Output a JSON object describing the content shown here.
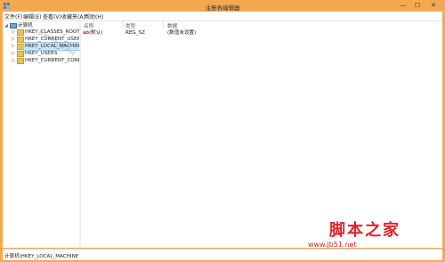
{
  "window": {
    "title": "注册表编辑器",
    "controls": {
      "minimize": "—",
      "maximize": "☐",
      "close": "✕"
    }
  },
  "menu": {
    "items": [
      "文件(F)",
      "编辑(E)",
      "查看(V)",
      "收藏夹(A)",
      "帮助(H)"
    ]
  },
  "tree": {
    "root": "计算机",
    "keys": [
      "HKEY_CLASSES_ROOT",
      "HKEY_CURRENT_USER",
      "HKEY_LOCAL_MACHINE",
      "HKEY_USERS",
      "HKEY_CURRENT_CONFIG"
    ],
    "selected_index": 2
  },
  "list": {
    "columns": [
      "名称",
      "类型",
      "数据"
    ],
    "rows": [
      {
        "name": "(默认)",
        "type": "REG_SZ",
        "data": "(数值未设置)",
        "icon": "ab-string-icon"
      }
    ]
  },
  "status": {
    "path": "计算机\\HKEY_LOCAL_MACHINE"
  },
  "watermarks": {
    "diagonal": "www.jb51.net",
    "brand": "脚本之家",
    "url": "www.jb51.net"
  },
  "colors": {
    "frame": "#f4a950",
    "selection": "#cce4f7",
    "folder": "#e8c25a",
    "brand": "#e0222a"
  }
}
